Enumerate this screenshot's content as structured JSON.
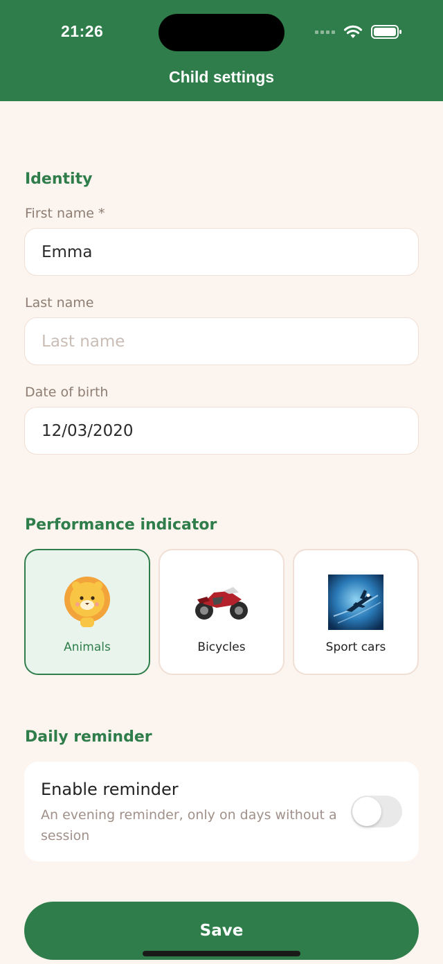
{
  "status_bar": {
    "time": "21:26"
  },
  "header": {
    "title": "Child settings"
  },
  "identity": {
    "section_title": "Identity",
    "first_name": {
      "label": "First name *",
      "value": "Emma",
      "placeholder": ""
    },
    "last_name": {
      "label": "Last name",
      "value": "",
      "placeholder": "Last name"
    },
    "date_of_birth": {
      "label": "Date of birth",
      "value": "12/03/2020",
      "placeholder": ""
    }
  },
  "performance_indicator": {
    "section_title": "Performance indicator",
    "options": [
      {
        "label": "Animals",
        "icon": "lion-icon",
        "selected": true
      },
      {
        "label": "Bicycles",
        "icon": "motorcycle-icon",
        "selected": false
      },
      {
        "label": "Sport cars",
        "icon": "jet-icon",
        "selected": false
      }
    ]
  },
  "daily_reminder": {
    "section_title": "Daily reminder",
    "title": "Enable reminder",
    "description": "An evening reminder, only on days without a session",
    "enabled": false
  },
  "actions": {
    "save_label": "Save"
  },
  "colors": {
    "primary": "#2e7d4a",
    "background": "#fcf4ee",
    "card_border": "#f0dfd4",
    "selected_bg": "#e8f4ec",
    "muted_text": "#8d7d73"
  }
}
